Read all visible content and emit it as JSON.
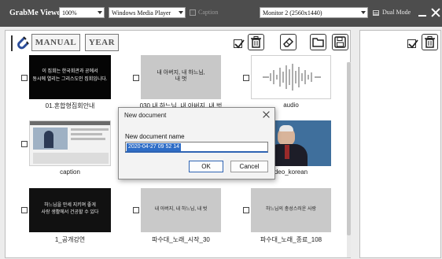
{
  "titlebar": {
    "app_name": "GrabMe Viewer",
    "zoom": "100%",
    "player": "Windows Media Player",
    "caption_label": "Caption",
    "monitor": "Monitor 2 (2560x1440)",
    "dual_mode_label": "Dual Mode"
  },
  "toolbar": {
    "manual_label": "MANUAL",
    "year_label": "YEAR"
  },
  "items": [
    {
      "caption": "01.혼합형집회안내",
      "lines": [
        "이 집회는 한국회관과 공에서",
        "동시에 열리는 그리스도인 집회입니다."
      ]
    },
    {
      "caption": "030 내 하느님, 내 아버지, 내 벗",
      "lines": [
        "내 아버지, 내 하느님,",
        "내 벗"
      ]
    },
    {
      "caption": "audio",
      "lines": []
    },
    {
      "caption": "caption",
      "lines": []
    },
    {
      "caption": "",
      "lines": []
    },
    {
      "caption": "deo_korean",
      "lines": []
    },
    {
      "caption": "1_공개강연",
      "lines": [
        "하느님을 만세 지키며 좋게",
        "사랑 생활에서 건공할 수 있다"
      ]
    },
    {
      "caption": "파수대_노래_시작_30",
      "lines": [
        "내 아버지, 내 하느님, 내 벗"
      ]
    },
    {
      "caption": "파수대_노래_종료_108",
      "lines": [
        "하느님의 충성스러운 사랑"
      ]
    }
  ],
  "dialog": {
    "title": "New document",
    "label": "New document name",
    "value": "2020-04-27 09 52 14",
    "ok_label": "OK",
    "cancel_label": "Cancel"
  },
  "colors": {
    "titlebar_bg": "#4d4d4d",
    "panel_bg": "#ffffff",
    "dialog_bg": "#f3f3f3",
    "selection": "#2f6dc6"
  }
}
